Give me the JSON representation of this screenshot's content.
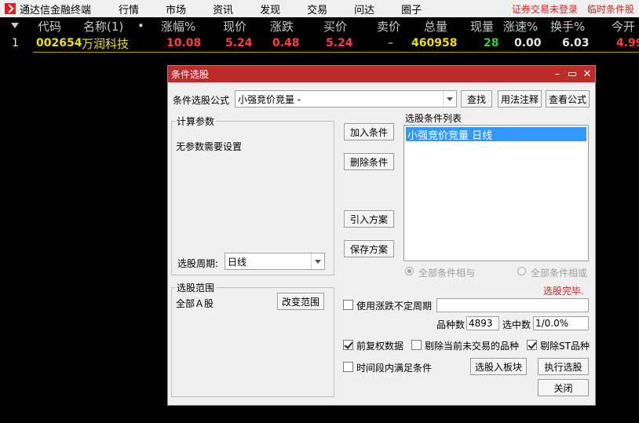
{
  "app": {
    "title": "通达信金融终端",
    "menu": [
      "行情",
      "市场",
      "资讯",
      "发现",
      "交易",
      "问达",
      "圈子"
    ],
    "status_login": "证券交易未登录",
    "status_condition": "临时条件股"
  },
  "grid": {
    "headers": [
      "代码",
      "名称(1)",
      "•",
      "涨幅%",
      "现价",
      "涨跌",
      "买价",
      "卖价",
      "总量",
      "现量",
      "涨速%",
      "换手%",
      "今开"
    ],
    "rows": [
      {
        "index": "1",
        "code": "002654",
        "name": "万润科技",
        "change_pct": "10.08",
        "price": "5.24",
        "change": "0.48",
        "bid": "5.24",
        "ask": "–",
        "volume": "460958",
        "last_volume": "28",
        "speed": "0.00",
        "turnover": "6.03",
        "open": "4.99"
      }
    ]
  },
  "dialog": {
    "title": "条件选股",
    "formula_label": "条件选股公式",
    "formula_value": "小强竞价竞量 -",
    "buttons": {
      "find": "查找",
      "usage": "用法注释",
      "view": "查看公式",
      "add": "加入条件",
      "delete": "删除条件",
      "import": "引入方案",
      "save": "保存方案",
      "change_range": "改变范围",
      "to_block": "选股入板块",
      "execute": "执行选股",
      "close": "关闭"
    },
    "params_group": "计算参数",
    "params_text": "无参数需要设置",
    "period_label": "选股周期:",
    "period_value": "日线",
    "list_group": "选股条件列表",
    "list_items": [
      "小强竞价竞量  日线"
    ],
    "radio_and": "全部条件相与",
    "radio_or": "全部条件相或",
    "status": "选股完毕.",
    "range_group": "选股范围",
    "range_value": "全部Ａ股",
    "chk_period": "使用涨跌不定周期",
    "count_label": "品种数",
    "count_value": "4893",
    "selected_label": "选中数",
    "selected_value": "1/0.0%",
    "chk_fq": "前复权数据",
    "chk_remove_notrade": "剔除当前未交易的品种",
    "chk_remove_st": "剔除ST品种",
    "chk_time": "时间段内满足条件"
  }
}
